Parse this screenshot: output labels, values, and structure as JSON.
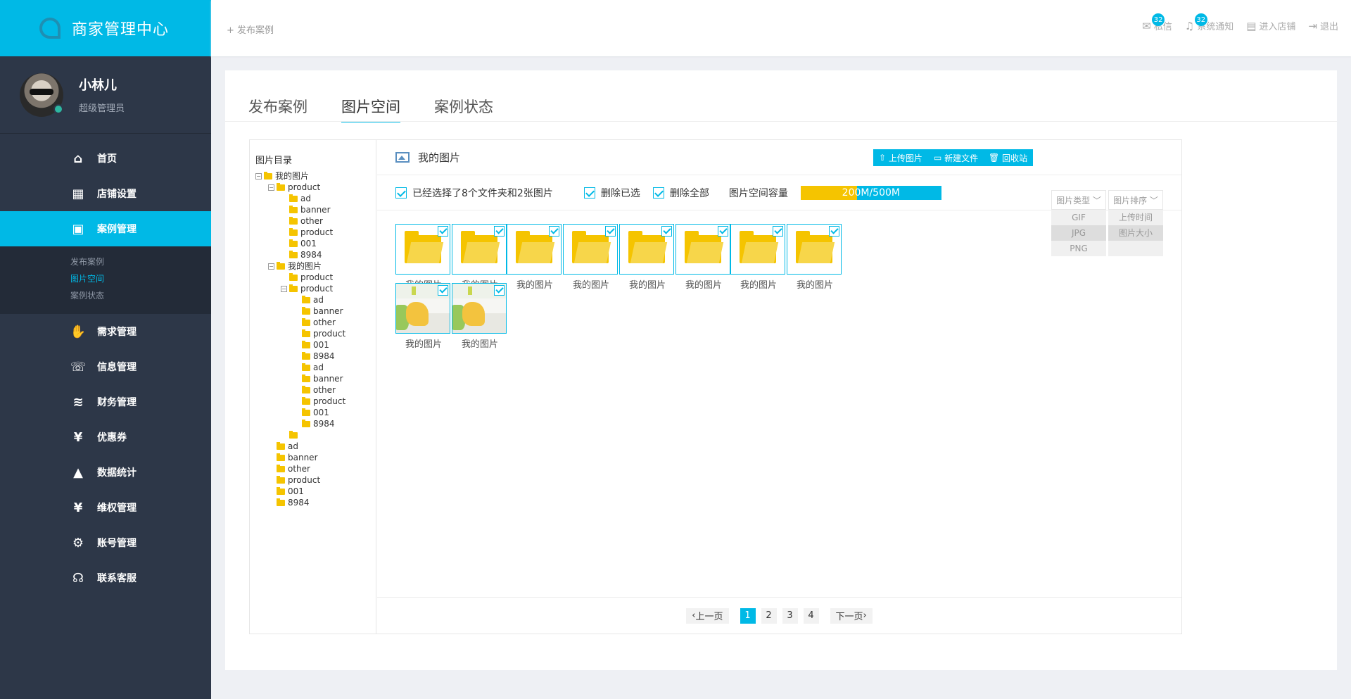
{
  "brand": {
    "title": "商家管理中心"
  },
  "user": {
    "name": "小林儿",
    "role": "超级管理员"
  },
  "menu": [
    {
      "label": "首页",
      "icon": "home-icon",
      "glyph": "⌂"
    },
    {
      "label": "店铺设置",
      "icon": "store-icon",
      "glyph": "▦"
    },
    {
      "label": "案例管理",
      "icon": "grid-icon",
      "glyph": "▣"
    },
    {
      "label": "需求管理",
      "icon": "hand-icon",
      "glyph": "✋"
    },
    {
      "label": "信息管理",
      "icon": "chat-icon",
      "glyph": "☏"
    },
    {
      "label": "财务管理",
      "icon": "coins-icon",
      "glyph": "≋"
    },
    {
      "label": "优惠券",
      "icon": "coupon-icon",
      "glyph": "¥"
    },
    {
      "label": "数据统计",
      "icon": "chart-icon",
      "glyph": "▲"
    },
    {
      "label": "维权管理",
      "icon": "shield-icon",
      "glyph": "¥"
    },
    {
      "label": "账号管理",
      "icon": "gear-icon",
      "glyph": "⚙"
    },
    {
      "label": "联系客服",
      "icon": "headset-icon",
      "glyph": "☊"
    }
  ],
  "submenu": [
    "发布案例",
    "图片空间",
    "案例状态"
  ],
  "topbar": {
    "publish": "+ 发布案例",
    "links": [
      {
        "label": "私信",
        "badge": "32",
        "icon": "mail-icon",
        "glyph": "✉"
      },
      {
        "label": "系统通知",
        "badge": "32",
        "icon": "bell-icon",
        "glyph": "♫"
      },
      {
        "label": "进入店铺",
        "icon": "shop-icon",
        "glyph": "▤"
      },
      {
        "label": "退出",
        "icon": "logout-icon",
        "glyph": "⇥"
      }
    ]
  },
  "tabs": [
    "发布案例",
    "图片空间",
    "案例状态"
  ],
  "tree": {
    "title": "图片目录",
    "nodes": [
      {
        "label": "我的图片",
        "depth": 0,
        "toggle": "−"
      },
      {
        "label": "product",
        "depth": 1,
        "toggle": "−"
      },
      {
        "label": "ad",
        "depth": 2
      },
      {
        "label": "banner",
        "depth": 2
      },
      {
        "label": "other",
        "depth": 2
      },
      {
        "label": "product",
        "depth": 2
      },
      {
        "label": "001",
        "depth": 2
      },
      {
        "label": "8984",
        "depth": 2
      },
      {
        "label": "我的图片",
        "depth": 1,
        "toggle": "−"
      },
      {
        "label": "product",
        "depth": 2
      },
      {
        "label": "product",
        "depth": 2,
        "toggle": "−"
      },
      {
        "label": "ad",
        "depth": 3
      },
      {
        "label": "banner",
        "depth": 3
      },
      {
        "label": "other",
        "depth": 3
      },
      {
        "label": "product",
        "depth": 3
      },
      {
        "label": "001",
        "depth": 3
      },
      {
        "label": "8984",
        "depth": 3
      },
      {
        "label": "ad",
        "depth": 3
      },
      {
        "label": "banner",
        "depth": 3
      },
      {
        "label": "other",
        "depth": 3
      },
      {
        "label": "product",
        "depth": 3
      },
      {
        "label": "001",
        "depth": 3
      },
      {
        "label": "8984",
        "depth": 3
      },
      {
        "label": "",
        "depth": 2
      },
      {
        "label": "ad",
        "depth": 1
      },
      {
        "label": "banner",
        "depth": 1
      },
      {
        "label": "other",
        "depth": 1
      },
      {
        "label": "product",
        "depth": 1
      },
      {
        "label": "001",
        "depth": 1
      },
      {
        "label": "8984",
        "depth": 1
      }
    ]
  },
  "gallery": {
    "title": "我的图片",
    "buttons": {
      "upload": "上传图片",
      "new_folder": "新建文件",
      "recycle": "回收站"
    },
    "toolbar": {
      "selected": "已经选择了8个文件夹和2张图片",
      "delete_selected": "删除已选",
      "delete_all": "删除全部",
      "capacity_label": "图片空间容量",
      "capacity_text": "200M/500M",
      "capacity_fraction": 0.4
    },
    "type_filter": {
      "label": "图片类型",
      "options": [
        "GIF",
        "JPG",
        "PNG"
      ],
      "selected": "JPG"
    },
    "sort_filter": {
      "label": "图片排序",
      "options": [
        "上传时间",
        "图片大小",
        ""
      ],
      "selected": "图片大小"
    },
    "items": [
      {
        "kind": "folder",
        "label": "我的图片"
      },
      {
        "kind": "folder",
        "label": "我的图片"
      },
      {
        "kind": "folder",
        "label": "我的图片"
      },
      {
        "kind": "folder",
        "label": "我的图片"
      },
      {
        "kind": "folder",
        "label": "我的图片"
      },
      {
        "kind": "folder",
        "label": "我的图片"
      },
      {
        "kind": "folder",
        "label": "我的图片"
      },
      {
        "kind": "folder",
        "label": "我的图片"
      },
      {
        "kind": "photo",
        "label": "我的图片"
      },
      {
        "kind": "photo",
        "label": "我的图片"
      }
    ]
  },
  "pager": {
    "prev": "上一页",
    "next": "下一页",
    "pages": [
      "1",
      "2",
      "3",
      "4"
    ],
    "current": "1"
  },
  "colors": {
    "accent": "#00b9e6",
    "sidebar": "#2d3748",
    "folder": "#f5c400"
  }
}
